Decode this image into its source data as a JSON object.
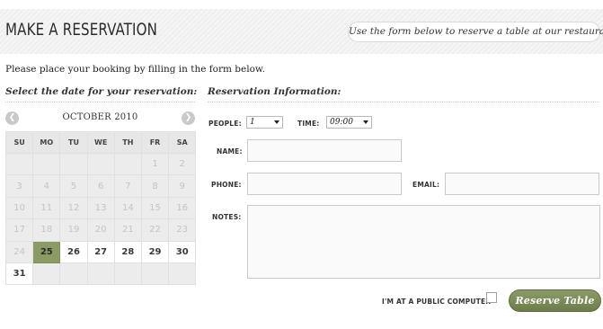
{
  "header": {
    "title": "MAKE A RESERVATION",
    "tagline": "Use the form below to reserve a table at our restaurant"
  },
  "intro": "Please place your booking by filling in the form below.",
  "calendar": {
    "heading": "Select the date for your reservation:",
    "month": "OCTOBER 2010",
    "prev_icon": "chevron-left-icon",
    "next_icon": "chevron-right-icon",
    "weekdays": [
      "SU",
      "MO",
      "TU",
      "WE",
      "TH",
      "FR",
      "SA"
    ],
    "weeks": [
      [
        "",
        "",
        "",
        "",
        "",
        "1",
        "2"
      ],
      [
        "3",
        "4",
        "5",
        "6",
        "7",
        "8",
        "9"
      ],
      [
        "10",
        "11",
        "12",
        "13",
        "14",
        "15",
        "16"
      ],
      [
        "17",
        "18",
        "19",
        "20",
        "21",
        "22",
        "23"
      ],
      [
        "24",
        "25",
        "26",
        "27",
        "28",
        "29",
        "30"
      ],
      [
        "31",
        "",
        "",
        "",
        "",
        "",
        ""
      ]
    ],
    "selected_day": "25",
    "first_available_day": "25",
    "selected_color": "#8a9b64"
  },
  "form": {
    "heading": "Reservation Information:",
    "people_label": "PEOPLE:",
    "people_value": "1",
    "time_label": "TIME:",
    "time_value": "09:00",
    "name_label": "NAME:",
    "name_value": "",
    "phone_label": "PHONE:",
    "phone_value": "",
    "email_label": "EMAIL:",
    "email_value": "",
    "notes_label": "NOTES:",
    "notes_value": "",
    "public_computer_label": "I'M AT A PUBLIC COMPUTER",
    "public_computer_checked": false,
    "submit_label": "Reserve Table",
    "accent_color": "#7a8a56"
  }
}
